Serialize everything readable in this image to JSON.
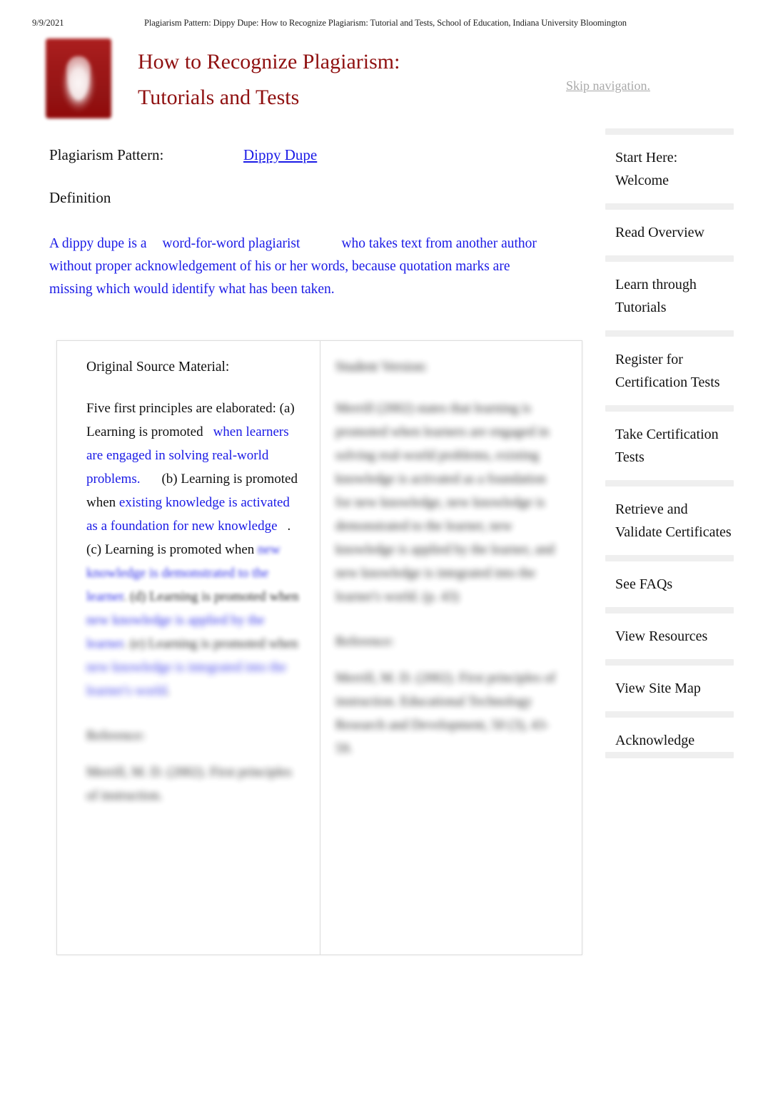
{
  "print_header": {
    "date": "9/9/2021",
    "title": "Plagiarism Pattern: Dippy Dupe: How to Recognize Plagiarism: Tutorial and Tests, School of Education, Indiana University Bloomington"
  },
  "masthead": {
    "logo_alt": "Indiana University trident logo",
    "title_line1": "How to Recognize Plagiarism:",
    "title_line2": "Tutorials and Tests",
    "skip_nav": "Skip navigation.",
    "brand_color": "#8f1010"
  },
  "main": {
    "pattern_label": "Plagiarism Pattern:",
    "pattern_value": "Dippy Dupe",
    "definition_label": "Definition",
    "definition_parts": {
      "p1": "A dippy dupe is a",
      "p2": "word-for-word plagiarist",
      "p3": "who takes text from another author without proper acknowledgement of his or her words, because quotation marks are missing which would identify what has been taken."
    },
    "link_color": "#1a1ae6"
  },
  "comparison": {
    "left": {
      "heading": "Original Source Material:",
      "body_parts": {
        "s1": "Five first principles are elaborated: (a) Learning is promoted",
        "s2": "when learners are engaged in solving real-world problems.",
        "s3": "(b) Learning is promoted when",
        "s4": "existing knowledge is activated as a foundation for new knowledge",
        "s5": ". (c) Learning is promoted when",
        "s6": "new knowledge is demonstrated to the learner",
        "s7": ". (d) Learning is promoted when",
        "s8": "new knowledge is applied by the learner",
        "s9": ". (e) Learning is promoted when",
        "s10": "new knowledge is integrated into the learner's world",
        "s11": "."
      },
      "reference_heading": "Reference:",
      "reference_body": "Merrill, M. D. (2002). First principles of instruction."
    },
    "right": {
      "heading": "Student Version:",
      "body": "Merrill (2002) states that learning is promoted when learners are engaged in solving real-world problems, existing knowledge is activated as a foundation for new knowledge, new knowledge is demonstrated to the learner, new knowledge is applied by the learner, and new knowledge is integrated into the learner's world. (p. 43)",
      "reference_heading": "Reference:",
      "reference_body": "Merrill, M. D. (2002). First principles of instruction. Educational Technology Research and Development, 50 (3), 43-59."
    }
  },
  "sidebar": {
    "items": [
      {
        "label": "Start Here: Welcome"
      },
      {
        "label": "Read Overview"
      },
      {
        "label": "Learn through Tutorials"
      },
      {
        "label": "Register for Certification Tests"
      },
      {
        "label": "Take Certification Tests"
      },
      {
        "label": "Retrieve and Validate Certificates"
      },
      {
        "label": "See FAQs"
      },
      {
        "label": "View Resources"
      },
      {
        "label": "View Site Map"
      },
      {
        "label": "Acknowledge"
      }
    ]
  }
}
